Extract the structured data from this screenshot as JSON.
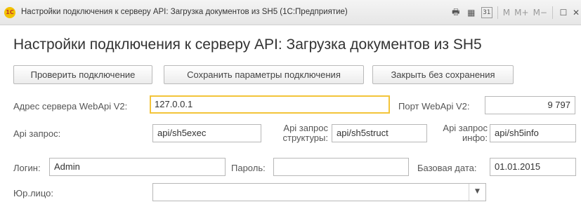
{
  "window": {
    "title": "Настройки подключения к серверу API: Загрузка документов из SH5  (1С:Предприятие)",
    "logo_text": "1С",
    "icons": {
      "print": "🖶",
      "calc": "▦",
      "calendar": "31",
      "m": "M",
      "m_plus": "M+",
      "m_minus": "M−",
      "maximize": "☐",
      "close": "✕"
    }
  },
  "form": {
    "title": "Настройки подключения к серверу API: Загрузка документов из SH5"
  },
  "toolbar": {
    "check_label": "Проверить подключение",
    "save_label": "Сохранить параметры подключения",
    "close_label": "Закрыть без сохранения"
  },
  "fields": {
    "server_label": "Адрес сервера WebApi V2:",
    "server_value": "127.0.0.1",
    "port_label": "Порт WebApi V2:",
    "port_value": "9 797",
    "api_label": "Api запрос:",
    "api_value": "api/sh5exec",
    "api_struct_label": "Api запрос структуры:",
    "api_struct_value": "api/sh5struct",
    "api_info_label": "Api запрос инфо:",
    "api_info_value": "api/sh5info",
    "login_label": "Логин:",
    "login_value": "Admin",
    "password_label": "Пароль:",
    "password_value": "",
    "base_date_label": "Базовая дата:",
    "base_date_value": "01.01.2015",
    "org_label": "Юр.лицо:",
    "org_value": ""
  },
  "colors": {
    "focus_border": "#f3c43a",
    "logo_bg": "#f2c200",
    "logo_text": "#c0392b"
  }
}
